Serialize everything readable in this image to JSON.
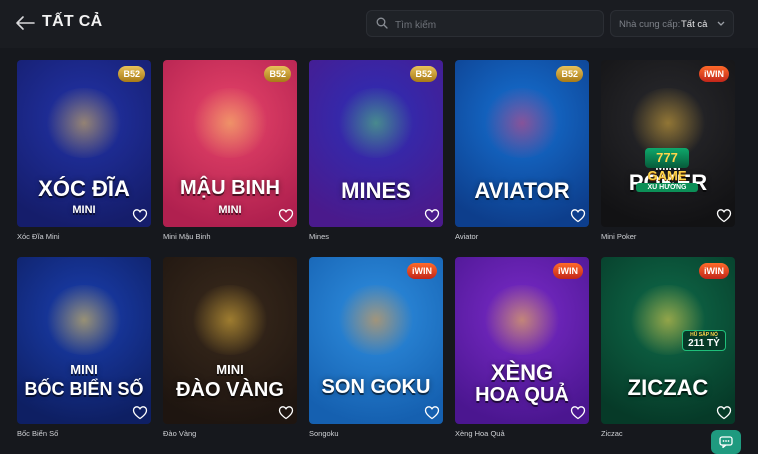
{
  "header": {
    "title": "TẤT CẢ",
    "search_placeholder": "Tìm kiếm",
    "provider_label": "Nhà cung cấp:",
    "provider_value": "Tất cả"
  },
  "games": [
    {
      "caption": "Xóc Đĩa Mini",
      "line1": "XÓC ĐĨA",
      "line2": "MINI",
      "badge": "B52",
      "bg": "#2233a8",
      "bg2": "#151d6b",
      "accent": "#f1c44b"
    },
    {
      "caption": "Mini Mậu Binh",
      "line1": "MẬU BINH",
      "line2": "MINI",
      "badge": "B52",
      "bg": "#e8456a",
      "bg2": "#b0204f",
      "accent": "#f6d168"
    },
    {
      "caption": "Mines",
      "line1": "MINES",
      "line2": "",
      "badge": "B52",
      "bg": "#2b2fb8",
      "bg2": "#4a1a8c",
      "accent": "#5fd46d"
    },
    {
      "caption": "Aviator",
      "line1": "AVIATOR",
      "line2": "",
      "badge": "B52",
      "bg": "#1672d4",
      "bg2": "#0d3e8c",
      "accent": "#e23b6b"
    },
    {
      "caption": "Mini Poker",
      "line1": "POKER",
      "line2": "MINI",
      "badge": "iWIN",
      "bg": "#2a2a2e",
      "bg2": "#121214",
      "accent": "#e6b43c"
    },
    {
      "caption": "Bốc Biển Số",
      "line1": "BỐC BIỂN SỐ",
      "line2": "MINI",
      "badge": "",
      "bg": "#1a3fb0",
      "bg2": "#0e1f63",
      "accent": "#ffd447"
    },
    {
      "caption": "Đào Vàng",
      "line1": "ĐÀO VÀNG",
      "line2": "MINI",
      "badge": "",
      "bg": "#3a2a1c",
      "bg2": "#1e1510",
      "accent": "#f0c040"
    },
    {
      "caption": "Songoku",
      "line1": "SON GOKU",
      "line2": "",
      "badge": "iWIN",
      "bg": "#2f8fe0",
      "bg2": "#1560b0",
      "accent": "#ff9a2a"
    },
    {
      "caption": "Xèng Hoa Quả",
      "line1": "XÈNG",
      "line2": "HOA QUẢ",
      "badge": "iWIN",
      "bg": "#7a2bc9",
      "bg2": "#4b1690",
      "accent": "#ffcf3a"
    },
    {
      "caption": "Ziczac",
      "line1": "ZICZAC",
      "line2": "",
      "badge": "iWIN",
      "bg": "#0f6b4a",
      "bg2": "#063a28",
      "accent": "#ffd54a"
    }
  ],
  "promo": {
    "line1": "GAME",
    "line2": "XU HƯỚNG",
    "jackpot_label": "HŨ SẮP NỔ",
    "jackpot_value": "211 TỶ"
  }
}
